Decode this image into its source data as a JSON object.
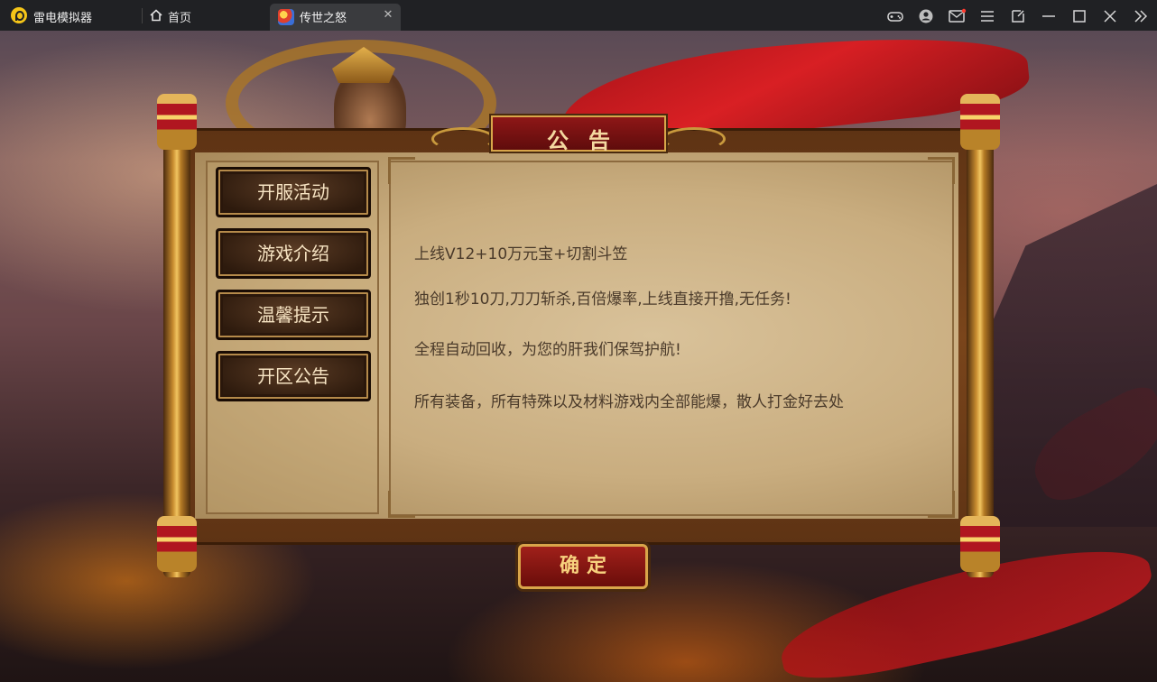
{
  "titlebar": {
    "app_name": "雷电模拟器",
    "home_tab_label": "首页",
    "game_tab_label": "传世之怒",
    "close_glyph": "✕",
    "icons": [
      "gamepad-icon",
      "user-icon",
      "mail-icon",
      "menu-icon",
      "resize-icon",
      "minimize-icon",
      "maximize-icon",
      "close-icon",
      "expand-icon"
    ]
  },
  "notice": {
    "title": "公告",
    "menu": [
      "开服活动",
      "游戏介绍",
      "温馨提示",
      "开区公告"
    ],
    "lines": [
      "上线V12+10万元宝+切割斗笠",
      "独创1秒10刀,刀刀斩杀,百倍爆率,上线直接开撸,无任务!",
      "全程自动回收，为您的肝我们保驾护航!",
      "所有装备，所有特殊以及材料游戏内全部能爆，散人打金好去处"
    ],
    "confirm_label": "确定"
  },
  "colors": {
    "titlebar_bg": "#202124",
    "active_tab_bg": "#3a3b3e",
    "scroll_wood": "#7a451b",
    "parchment": "#c9ad7f",
    "notice_red": "#8e1717",
    "gold_text": "#f8d27e",
    "body_text": "#4a3a2a"
  }
}
